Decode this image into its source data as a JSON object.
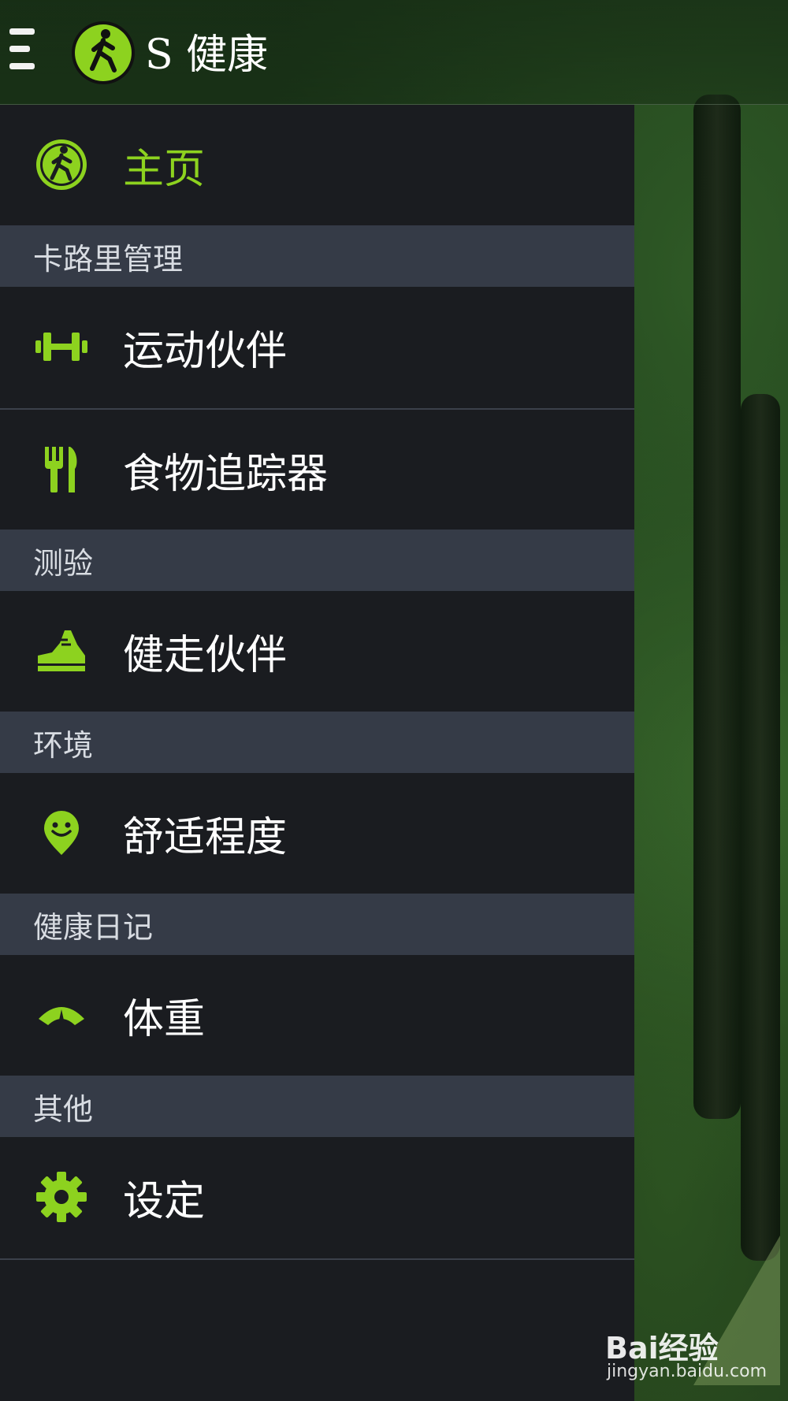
{
  "header": {
    "app_title": "S 健康",
    "menu_icon": "hamburger-menu-icon",
    "logo_icon": "walking-person-icon"
  },
  "drawer": {
    "home": {
      "label": "主页",
      "icon": "walking-person-icon"
    },
    "sections": [
      {
        "title": "卡路里管理",
        "items": [
          {
            "label": "运动伙伴",
            "icon": "dumbbell-icon"
          },
          {
            "label": "食物追踪器",
            "icon": "fork-knife-icon"
          }
        ]
      },
      {
        "title": "测验",
        "items": [
          {
            "label": "健走伙伴",
            "icon": "sneaker-icon"
          }
        ]
      },
      {
        "title": "环境",
        "items": [
          {
            "label": "舒适程度",
            "icon": "smiley-pin-icon"
          }
        ]
      },
      {
        "title": "健康日记",
        "items": [
          {
            "label": "体重",
            "icon": "scale-gauge-icon"
          }
        ]
      },
      {
        "title": "其他",
        "items": [
          {
            "label": "设定",
            "icon": "gear-icon"
          }
        ]
      }
    ]
  },
  "colors": {
    "accent": "#8dd21f",
    "drawer_bg": "#1a1c20",
    "section_bg": "#353b47"
  },
  "watermark": {
    "brand": "Bai经验",
    "url": "jingyan.baidu.com"
  }
}
